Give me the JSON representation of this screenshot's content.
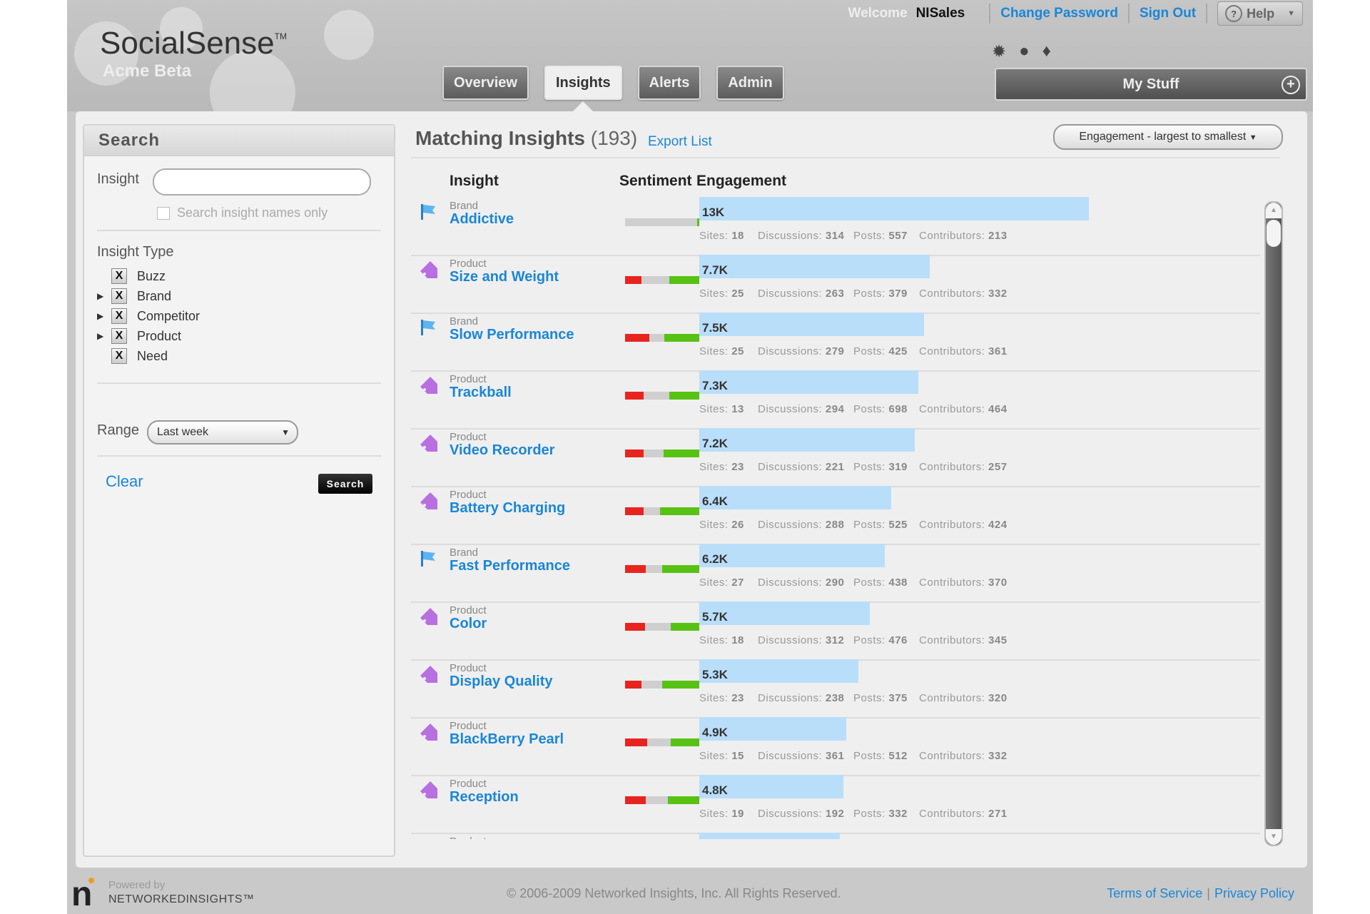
{
  "app": {
    "logo": "SocialSense",
    "logo_tm": "TM",
    "subtitle": "Acme Beta"
  },
  "topbar": {
    "welcome": "Welcome",
    "user": "NISales",
    "change_password": "Change Password",
    "sign_out": "Sign Out",
    "help": "Help"
  },
  "tabs": [
    "Overview",
    "Insights",
    "Alerts",
    "Admin"
  ],
  "active_tab": "Insights",
  "mystuff": "My Stuff",
  "search_panel": {
    "title": "Search",
    "insight_label": "Insight",
    "insight_value": "",
    "names_only": "Search insight names only",
    "type_title": "Insight Type",
    "types": [
      "Buzz",
      "Brand",
      "Competitor",
      "Product",
      "Need"
    ],
    "range_label": "Range",
    "range_value": "Last week",
    "clear": "Clear",
    "search": "Search"
  },
  "results": {
    "title": "Matching Insights",
    "count": "(193)",
    "export": "Export List",
    "sort": "Engagement - largest to smallest",
    "col_insight": "Insight",
    "col_sentiment": "Sentiment",
    "col_engagement": "Engagement",
    "labels": {
      "sites": "Sites:",
      "discussions": "Discussions:",
      "posts": "Posts:",
      "contributors": "Contributors:"
    },
    "max_engagement": 13,
    "rows": [
      {
        "cat": "Brand",
        "name": "Addictive",
        "eng_label": "13K",
        "engagement": 13.0,
        "sentiment": [
          0.0,
          0.97,
          0.03
        ],
        "sites": "18",
        "discussions": "314",
        "posts": "557",
        "contributors": "213",
        "icon": "flag"
      },
      {
        "cat": "Product",
        "name": "Size and Weight",
        "eng_label": "7.7K",
        "engagement": 7.7,
        "sentiment": [
          0.22,
          0.38,
          0.4
        ],
        "sites": "25",
        "discussions": "263",
        "posts": "379",
        "contributors": "332",
        "icon": "tag"
      },
      {
        "cat": "Brand",
        "name": "Slow Performance",
        "eng_label": "7.5K",
        "engagement": 7.5,
        "sentiment": [
          0.33,
          0.2,
          0.47
        ],
        "sites": "25",
        "discussions": "279",
        "posts": "425",
        "contributors": "361",
        "icon": "flag"
      },
      {
        "cat": "Product",
        "name": "Trackball",
        "eng_label": "7.3K",
        "engagement": 7.3,
        "sentiment": [
          0.25,
          0.35,
          0.4
        ],
        "sites": "13",
        "discussions": "294",
        "posts": "698",
        "contributors": "464",
        "icon": "tag"
      },
      {
        "cat": "Product",
        "name": "Video Recorder",
        "eng_label": "7.2K",
        "engagement": 7.2,
        "sentiment": [
          0.25,
          0.27,
          0.48
        ],
        "sites": "23",
        "discussions": "221",
        "posts": "319",
        "contributors": "257",
        "icon": "tag"
      },
      {
        "cat": "Product",
        "name": "Battery Charging",
        "eng_label": "6.4K",
        "engagement": 6.4,
        "sentiment": [
          0.25,
          0.22,
          0.53
        ],
        "sites": "26",
        "discussions": "288",
        "posts": "525",
        "contributors": "424",
        "icon": "tag"
      },
      {
        "cat": "Brand",
        "name": "Fast Performance",
        "eng_label": "6.2K",
        "engagement": 6.2,
        "sentiment": [
          0.28,
          0.22,
          0.5
        ],
        "sites": "27",
        "discussions": "290",
        "posts": "438",
        "contributors": "370",
        "icon": "flag"
      },
      {
        "cat": "Product",
        "name": "Color",
        "eng_label": "5.7K",
        "engagement": 5.7,
        "sentiment": [
          0.27,
          0.35,
          0.38
        ],
        "sites": "18",
        "discussions": "312",
        "posts": "476",
        "contributors": "345",
        "icon": "tag"
      },
      {
        "cat": "Product",
        "name": "Display Quality",
        "eng_label": "5.3K",
        "engagement": 5.3,
        "sentiment": [
          0.22,
          0.28,
          0.5
        ],
        "sites": "23",
        "discussions": "238",
        "posts": "375",
        "contributors": "320",
        "icon": "tag"
      },
      {
        "cat": "Product",
        "name": "BlackBerry Pearl",
        "eng_label": "4.9K",
        "engagement": 4.9,
        "sentiment": [
          0.3,
          0.32,
          0.38
        ],
        "sites": "15",
        "discussions": "361",
        "posts": "512",
        "contributors": "332",
        "icon": "tag"
      },
      {
        "cat": "Product",
        "name": "Reception",
        "eng_label": "4.8K",
        "engagement": 4.8,
        "sentiment": [
          0.28,
          0.3,
          0.42
        ],
        "sites": "19",
        "discussions": "192",
        "posts": "332",
        "contributors": "271",
        "icon": "tag"
      },
      {
        "cat": "Product",
        "name": "",
        "eng_label": "",
        "engagement": 4.7,
        "sentiment": [
          0,
          0,
          0
        ],
        "sites": "",
        "discussions": "",
        "posts": "",
        "contributors": "",
        "icon": "tag"
      }
    ]
  },
  "colors": {
    "neg": "#e8241e",
    "neu": "#cfcfcf",
    "pos": "#58c214",
    "bar": "#b9defa",
    "link": "#1a86d6"
  },
  "footer": {
    "powered": "Powered by",
    "company": "NETWORKEDINSIGHTS™",
    "copyright": "© 2006-2009 Networked Insights, Inc. All Rights Reserved.",
    "terms": "Terms of Service",
    "sep": "|",
    "privacy": "Privacy Policy"
  }
}
